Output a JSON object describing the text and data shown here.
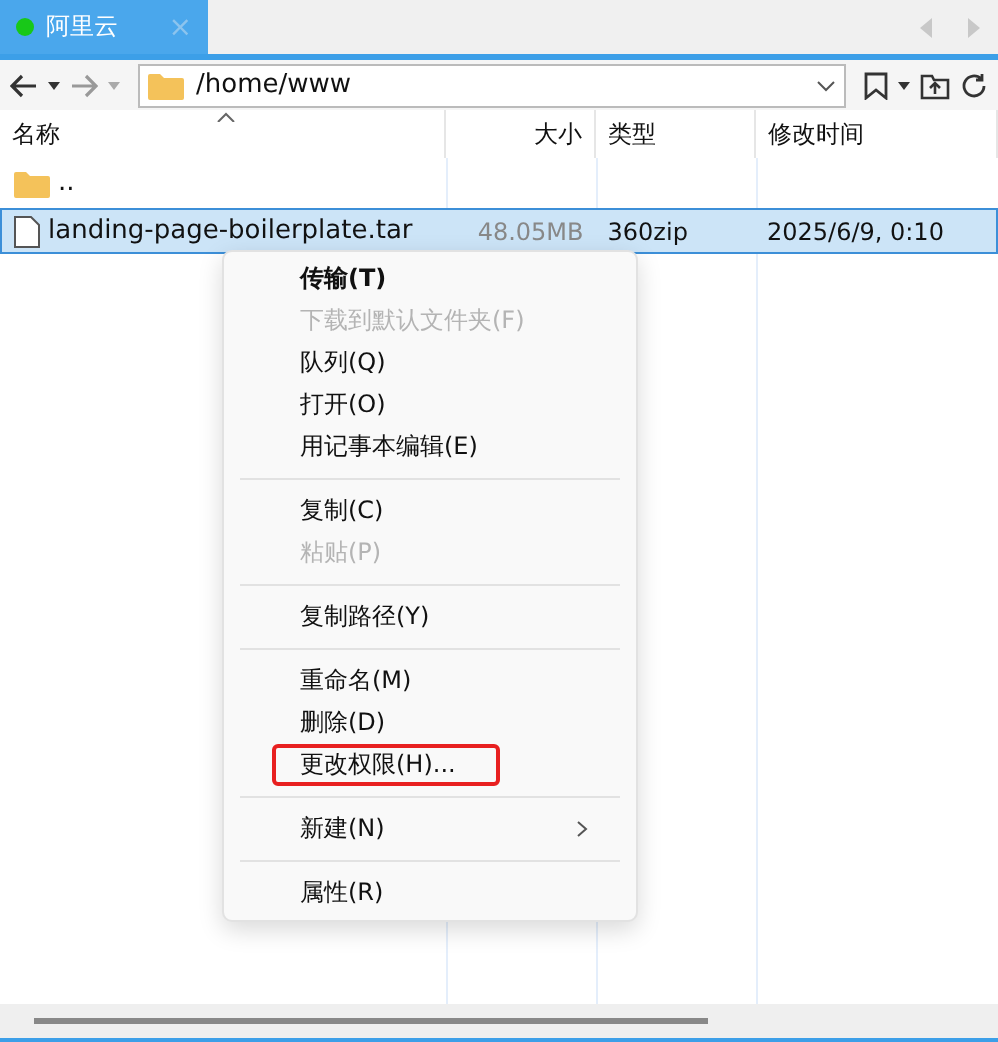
{
  "tabs": [
    {
      "label": "阿里云",
      "selected": true,
      "connected": true,
      "close": "×"
    }
  ],
  "toolbar": {
    "path": "/home/www"
  },
  "table": {
    "columns": [
      "名称",
      "大小",
      "类型",
      "修改时间"
    ],
    "rows": [
      {
        "kind": "folder",
        "name": "..",
        "selected": false
      },
      {
        "kind": "file",
        "name": "landing-page-boilerplate.tar",
        "size": "48.05MB",
        "type": "360zip",
        "modified": "2025/6/9, 0:10",
        "selected": true
      }
    ]
  },
  "context_menu": [
    {
      "kind": "item",
      "label": "传输(T)",
      "default": true,
      "disabled": false,
      "highlighted": false
    },
    {
      "kind": "item",
      "label": "下载到默认文件夹(F)",
      "default": false,
      "disabled": true,
      "highlighted": false
    },
    {
      "kind": "item",
      "label": "队列(Q)",
      "default": false,
      "disabled": false,
      "highlighted": false
    },
    {
      "kind": "item",
      "label": "打开(O)",
      "default": false,
      "disabled": false,
      "highlighted": false
    },
    {
      "kind": "item",
      "label": "用记事本编辑(E)",
      "default": false,
      "disabled": false,
      "highlighted": false
    },
    {
      "kind": "separator"
    },
    {
      "kind": "item",
      "label": "复制(C)",
      "default": false,
      "disabled": false,
      "highlighted": false
    },
    {
      "kind": "item",
      "label": "粘贴(P)",
      "default": false,
      "disabled": true,
      "highlighted": false
    },
    {
      "kind": "separator"
    },
    {
      "kind": "item",
      "label": "复制路径(Y)",
      "default": false,
      "disabled": false,
      "highlighted": false
    },
    {
      "kind": "separator"
    },
    {
      "kind": "item",
      "label": "重命名(M)",
      "default": false,
      "disabled": false,
      "highlighted": false
    },
    {
      "kind": "item",
      "label": "删除(D)",
      "default": false,
      "disabled": false,
      "highlighted": false
    },
    {
      "kind": "item",
      "label": "更改权限(H)...",
      "default": false,
      "disabled": false,
      "highlighted": true
    },
    {
      "kind": "separator"
    },
    {
      "kind": "submenu",
      "label": "新建(N)",
      "default": false,
      "disabled": false,
      "highlighted": false
    },
    {
      "kind": "separator"
    },
    {
      "kind": "item",
      "label": "属性(R)",
      "default": false,
      "disabled": false,
      "highlighted": false
    }
  ]
}
